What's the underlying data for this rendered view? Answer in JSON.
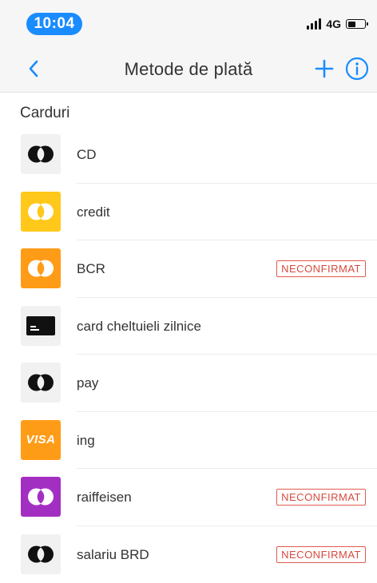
{
  "status_bar": {
    "time": "10:04",
    "network": "4G",
    "battery_level": 0.45
  },
  "nav": {
    "title": "Metode de plată",
    "back_icon": "chevron-left-icon",
    "add_icon": "plus-icon",
    "info_icon": "info-icon",
    "accent_color": "#1a8cff"
  },
  "section": {
    "title": "Carduri"
  },
  "cards": [
    {
      "label": "CD",
      "icon": "mastercard-icon",
      "icon_color": "#f1f1f1",
      "badge": ""
    },
    {
      "label": "credit",
      "icon": "mastercard-icon",
      "icon_color": "#ffc81a",
      "badge": ""
    },
    {
      "label": "BCR",
      "icon": "mastercard-icon",
      "icon_color": "#ff9c17",
      "badge": "NECONFIRMAT"
    },
    {
      "label": "card cheltuieli zilnice",
      "icon": "generic-card-icon",
      "icon_color": "#f1f1f1",
      "badge": ""
    },
    {
      "label": "pay",
      "icon": "mastercard-icon",
      "icon_color": "#f1f1f1",
      "badge": ""
    },
    {
      "label": "ing",
      "icon": "visa-icon",
      "icon_color": "#ff9c17",
      "icon_text": "VISA",
      "badge": ""
    },
    {
      "label": "raiffeisen",
      "icon": "mastercard-icon",
      "icon_color": "#a32fc2",
      "badge": "NECONFIRMAT"
    },
    {
      "label": "salariu BRD",
      "icon": "mastercard-icon",
      "icon_color": "#f1f1f1",
      "badge": "NECONFIRMAT"
    }
  ],
  "badge_color": "#d64a3e"
}
